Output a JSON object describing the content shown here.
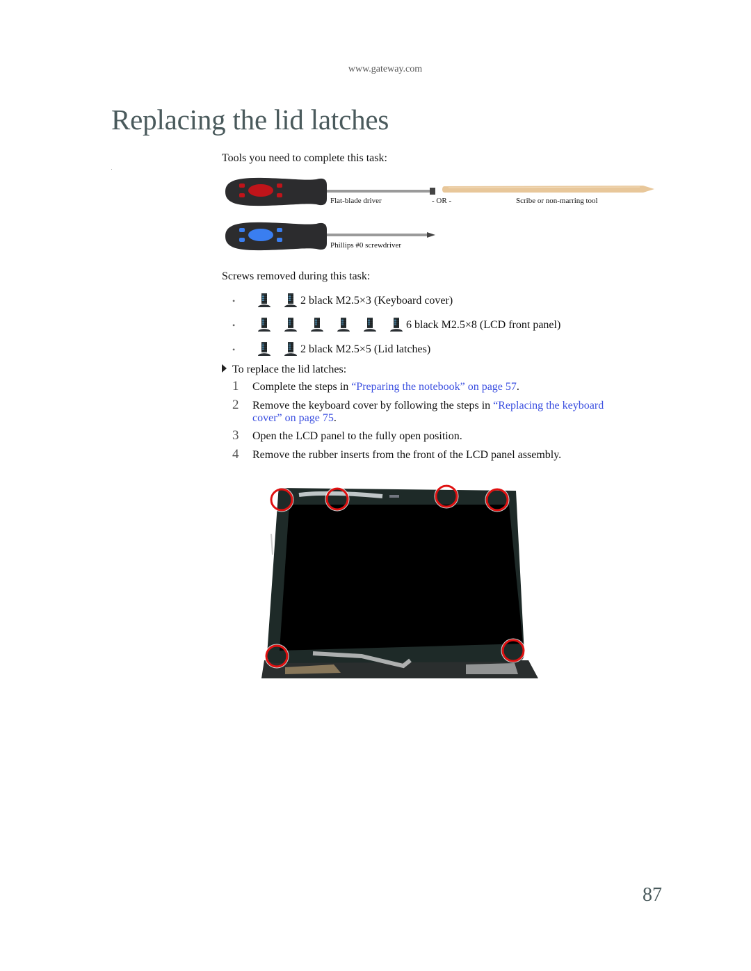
{
  "header": {
    "url": "www.gateway.com"
  },
  "page_title": "Replacing the lid latches",
  "tools": {
    "heading": "Tools you need to complete this task:",
    "items": [
      {
        "label": "Flat-blade driver",
        "icon": "flat-blade-screwdriver-icon",
        "handle_accent": "#c0141a"
      },
      {
        "separator": "- OR -"
      },
      {
        "label": "Scribe or non-marring tool",
        "icon": "scribe-tool-icon",
        "color": "#e8c79a"
      },
      {
        "label": "Phillips #0 screwdriver",
        "icon": "phillips-screwdriver-icon",
        "handle_accent": "#3a7ef0"
      }
    ]
  },
  "screws": {
    "heading": "Screws removed during this task:",
    "items": [
      {
        "count": 2,
        "label": "2 black M2.5×3 (Keyboard cover)"
      },
      {
        "count": 6,
        "label": "6 black M2.5×8 (LCD front panel)"
      },
      {
        "count": 2,
        "label": "2 black M2.5×5 (Lid latches)"
      }
    ]
  },
  "procedure": {
    "heading": "To replace the lid latches:",
    "steps": [
      {
        "num": "1",
        "text_before": "Complete the steps in ",
        "link": "“Preparing the notebook” on page 57",
        "text_after": "."
      },
      {
        "num": "2",
        "text_before": "Remove the keyboard cover by following the steps in ",
        "link": "“Replacing the keyboard",
        "link2": "cover” on page 75",
        "text_after": "."
      },
      {
        "num": "3",
        "text_before": "Open the LCD panel to the fully open position.",
        "link": "",
        "text_after": ""
      },
      {
        "num": "4",
        "text_before": "Remove the rubber inserts from the front of the LCD panel assembly.",
        "link": "",
        "text_after": ""
      }
    ]
  },
  "figure": {
    "description": "LCD panel with six rubber insert locations circled in red",
    "highlight_color": "#e01010",
    "circle_count": 6
  },
  "page_number": "87",
  "colors": {
    "link": "#3b4fe0",
    "title": "#4a5a5c"
  }
}
